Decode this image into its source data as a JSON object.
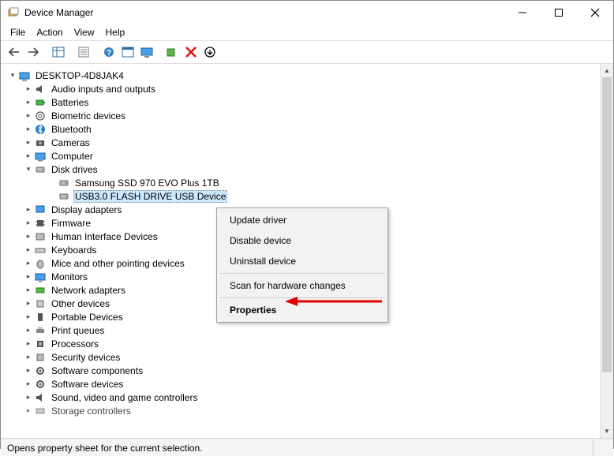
{
  "window": {
    "title": "Device Manager"
  },
  "menu": {
    "file": "File",
    "action": "Action",
    "view": "View",
    "help": "Help"
  },
  "tree": {
    "root": "DESKTOP-4D8JAK4",
    "items": [
      "Audio inputs and outputs",
      "Batteries",
      "Biometric devices",
      "Bluetooth",
      "Cameras",
      "Computer",
      "Disk drives",
      "Display adapters",
      "Firmware",
      "Human Interface Devices",
      "Keyboards",
      "Mice and other pointing devices",
      "Monitors",
      "Network adapters",
      "Other devices",
      "Portable Devices",
      "Print queues",
      "Processors",
      "Security devices",
      "Software components",
      "Software devices",
      "Sound, video and game controllers",
      "Storage controllers"
    ],
    "disk_children": [
      "Samsung SSD 970 EVO Plus 1TB",
      "USB3.0 FLASH DRIVE USB Device"
    ]
  },
  "context_menu": {
    "update": "Update driver",
    "disable": "Disable device",
    "uninstall": "Uninstall device",
    "scan": "Scan for hardware changes",
    "properties": "Properties"
  },
  "status": "Opens property sheet for the current selection."
}
